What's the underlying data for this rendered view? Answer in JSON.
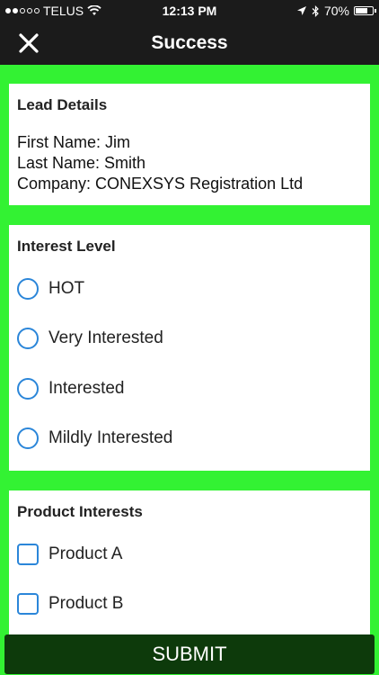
{
  "status_bar": {
    "carrier": "TELUS",
    "time": "12:13 PM",
    "battery": "70%",
    "battery_level": 0.7
  },
  "nav": {
    "title": "Success",
    "close_icon": "close-icon"
  },
  "lead_details": {
    "title": "Lead Details",
    "first_name": "First Name: Jim",
    "last_name": "Last Name: Smith",
    "company": "Company: CONEXSYS Registration Ltd"
  },
  "interest_level": {
    "title": "Interest Level",
    "options": [
      "HOT",
      "Very Interested",
      "Interested",
      "Mildly Interested"
    ]
  },
  "product_interests": {
    "title": "Product Interests",
    "options": [
      "Product A",
      "Product B"
    ]
  },
  "submit_label": "SUBMIT",
  "colors": {
    "background": "#33f233",
    "header": "#1b1b1b",
    "submit": "#0d3a0b",
    "control_border": "#2b86d9"
  }
}
